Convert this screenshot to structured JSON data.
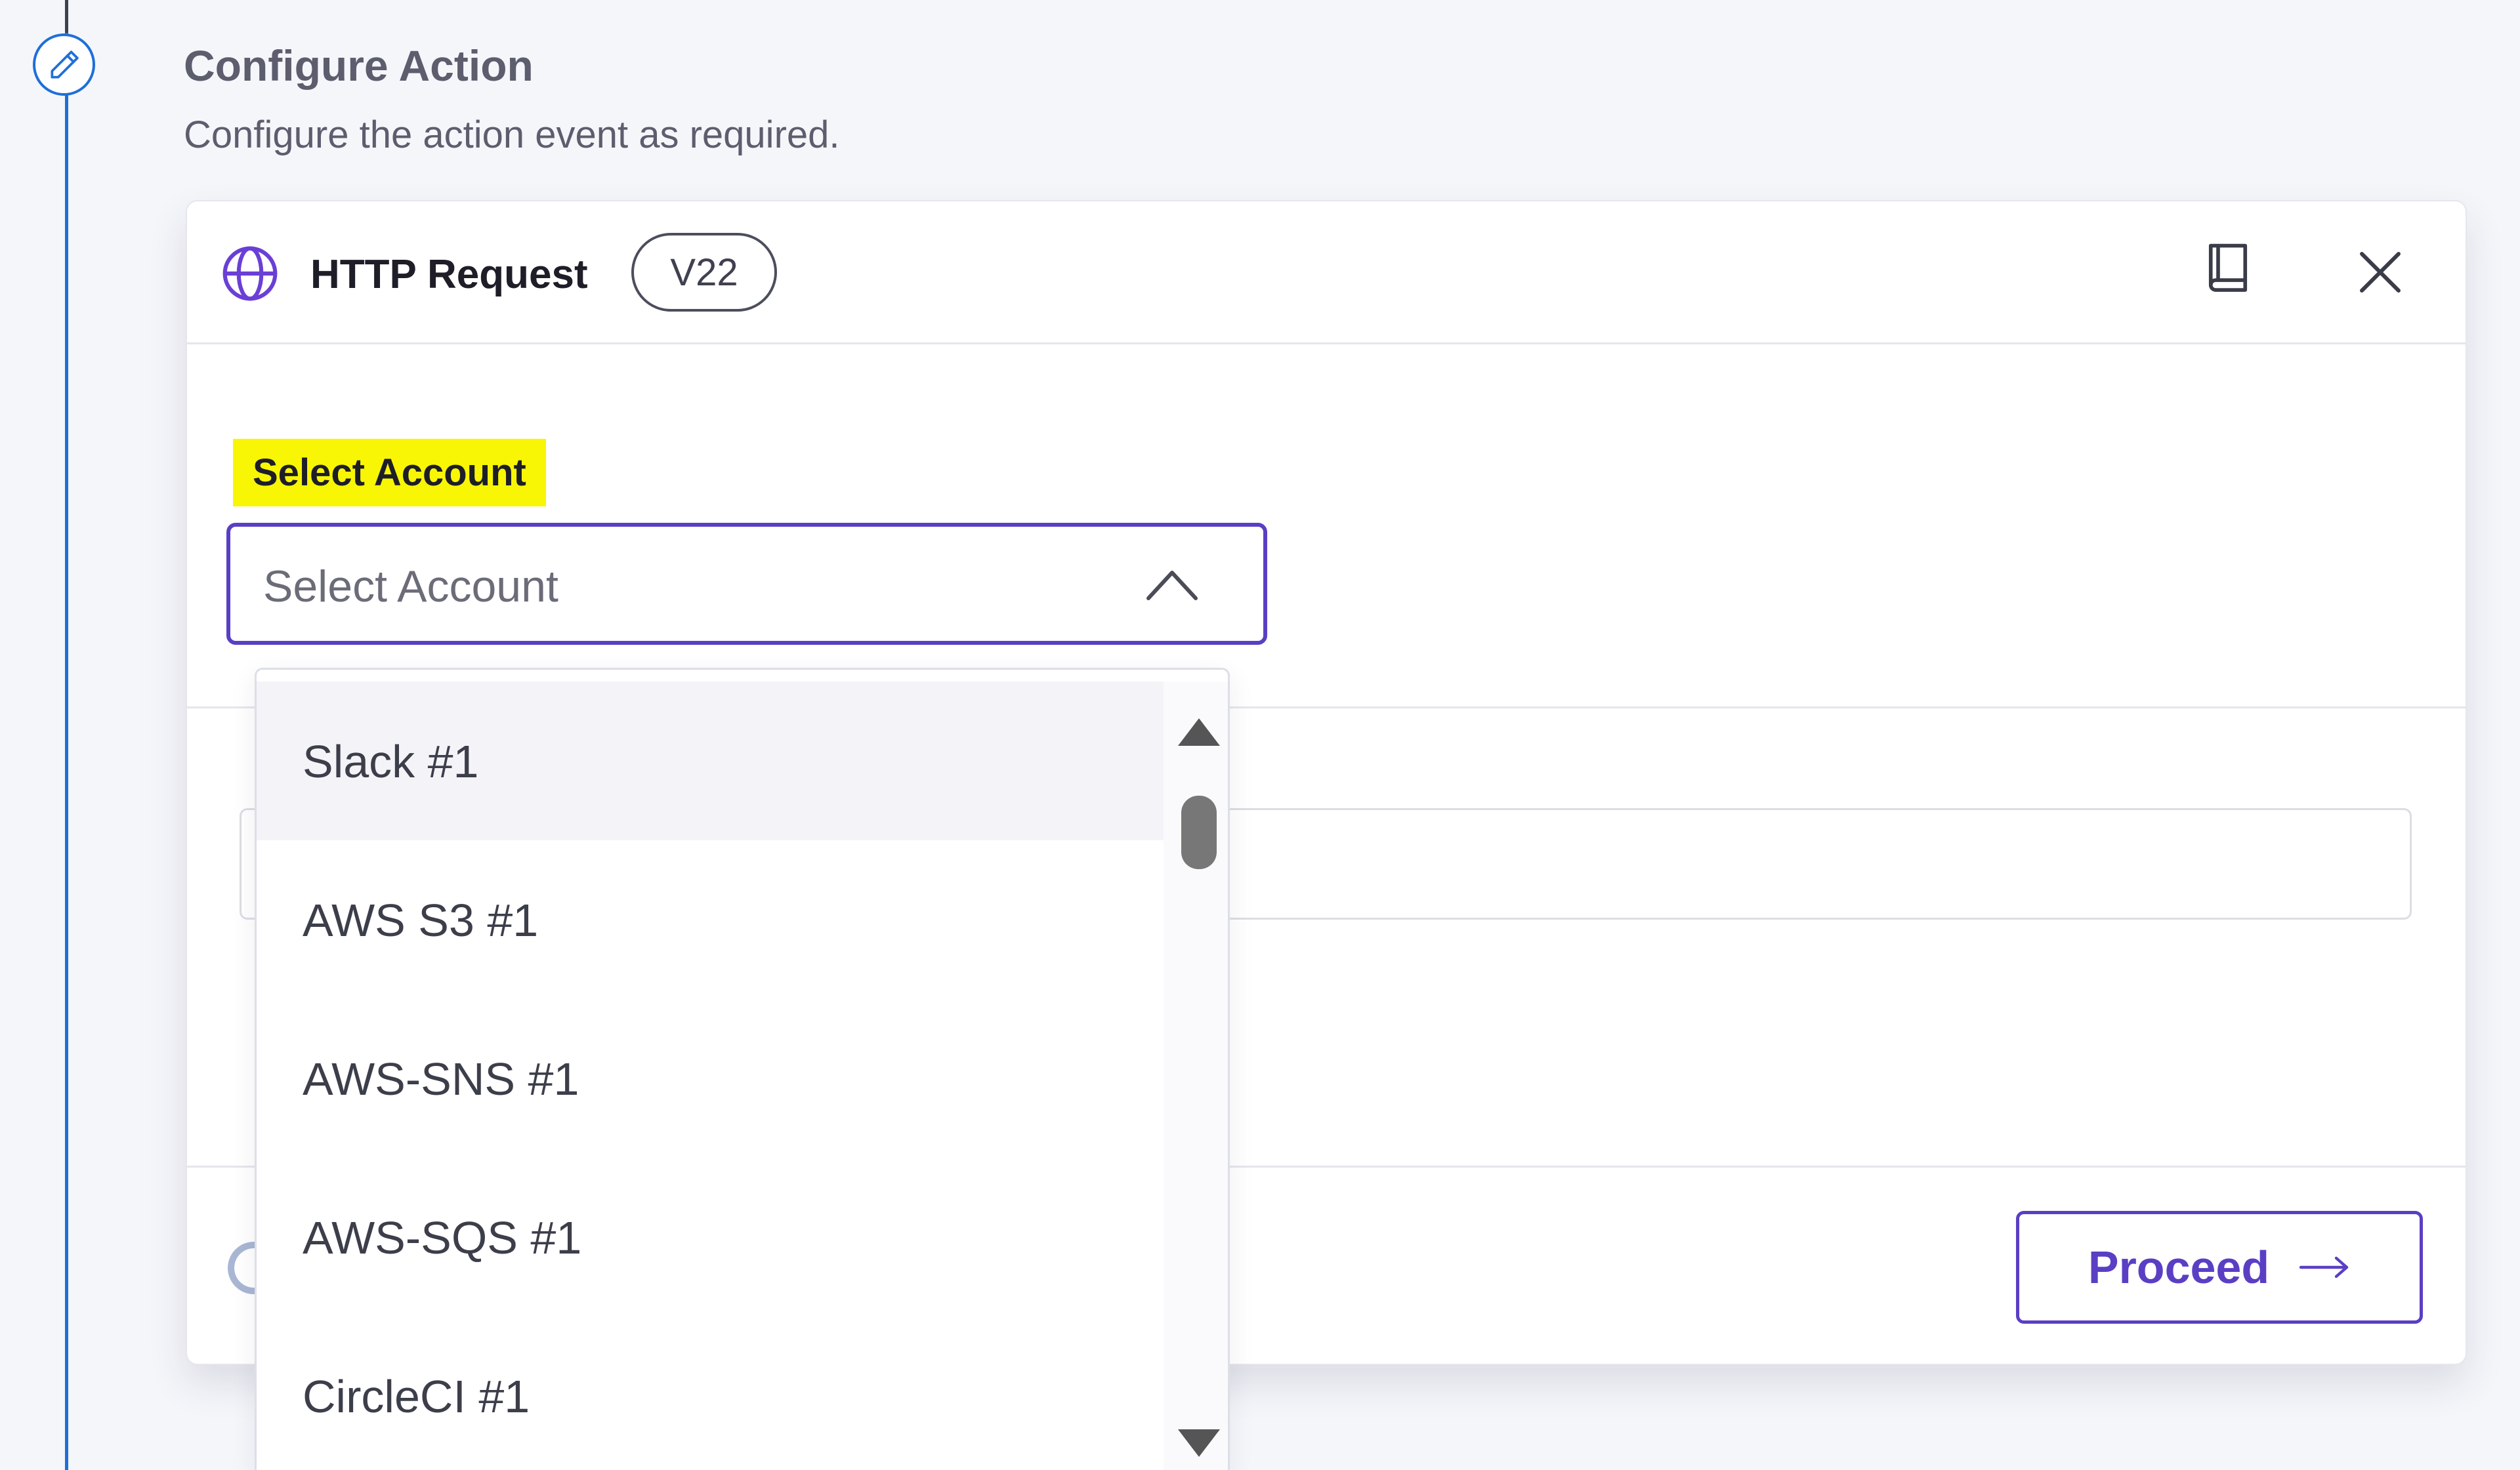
{
  "step": {
    "title": "Configure Action",
    "description": "Configure the action event as required."
  },
  "card": {
    "app_name": "HTTP Request",
    "version": "V22",
    "icons": {
      "app": "globe-icon",
      "docs": "book-icon",
      "close": "close-icon"
    }
  },
  "account_field": {
    "label": "Select Account",
    "placeholder": "Select Account",
    "is_open": true,
    "options": [
      "Slack #1",
      "AWS S3 #1",
      "AWS-SNS #1",
      "AWS-SQS #1",
      "CircleCI #1"
    ]
  },
  "footer": {
    "proceed_label": "Proceed"
  },
  "colors": {
    "accent": "#5a3fc4",
    "timeline": "#1f6fd8",
    "label_highlight": "#f8f604",
    "page_background": "#f5f6fa"
  }
}
